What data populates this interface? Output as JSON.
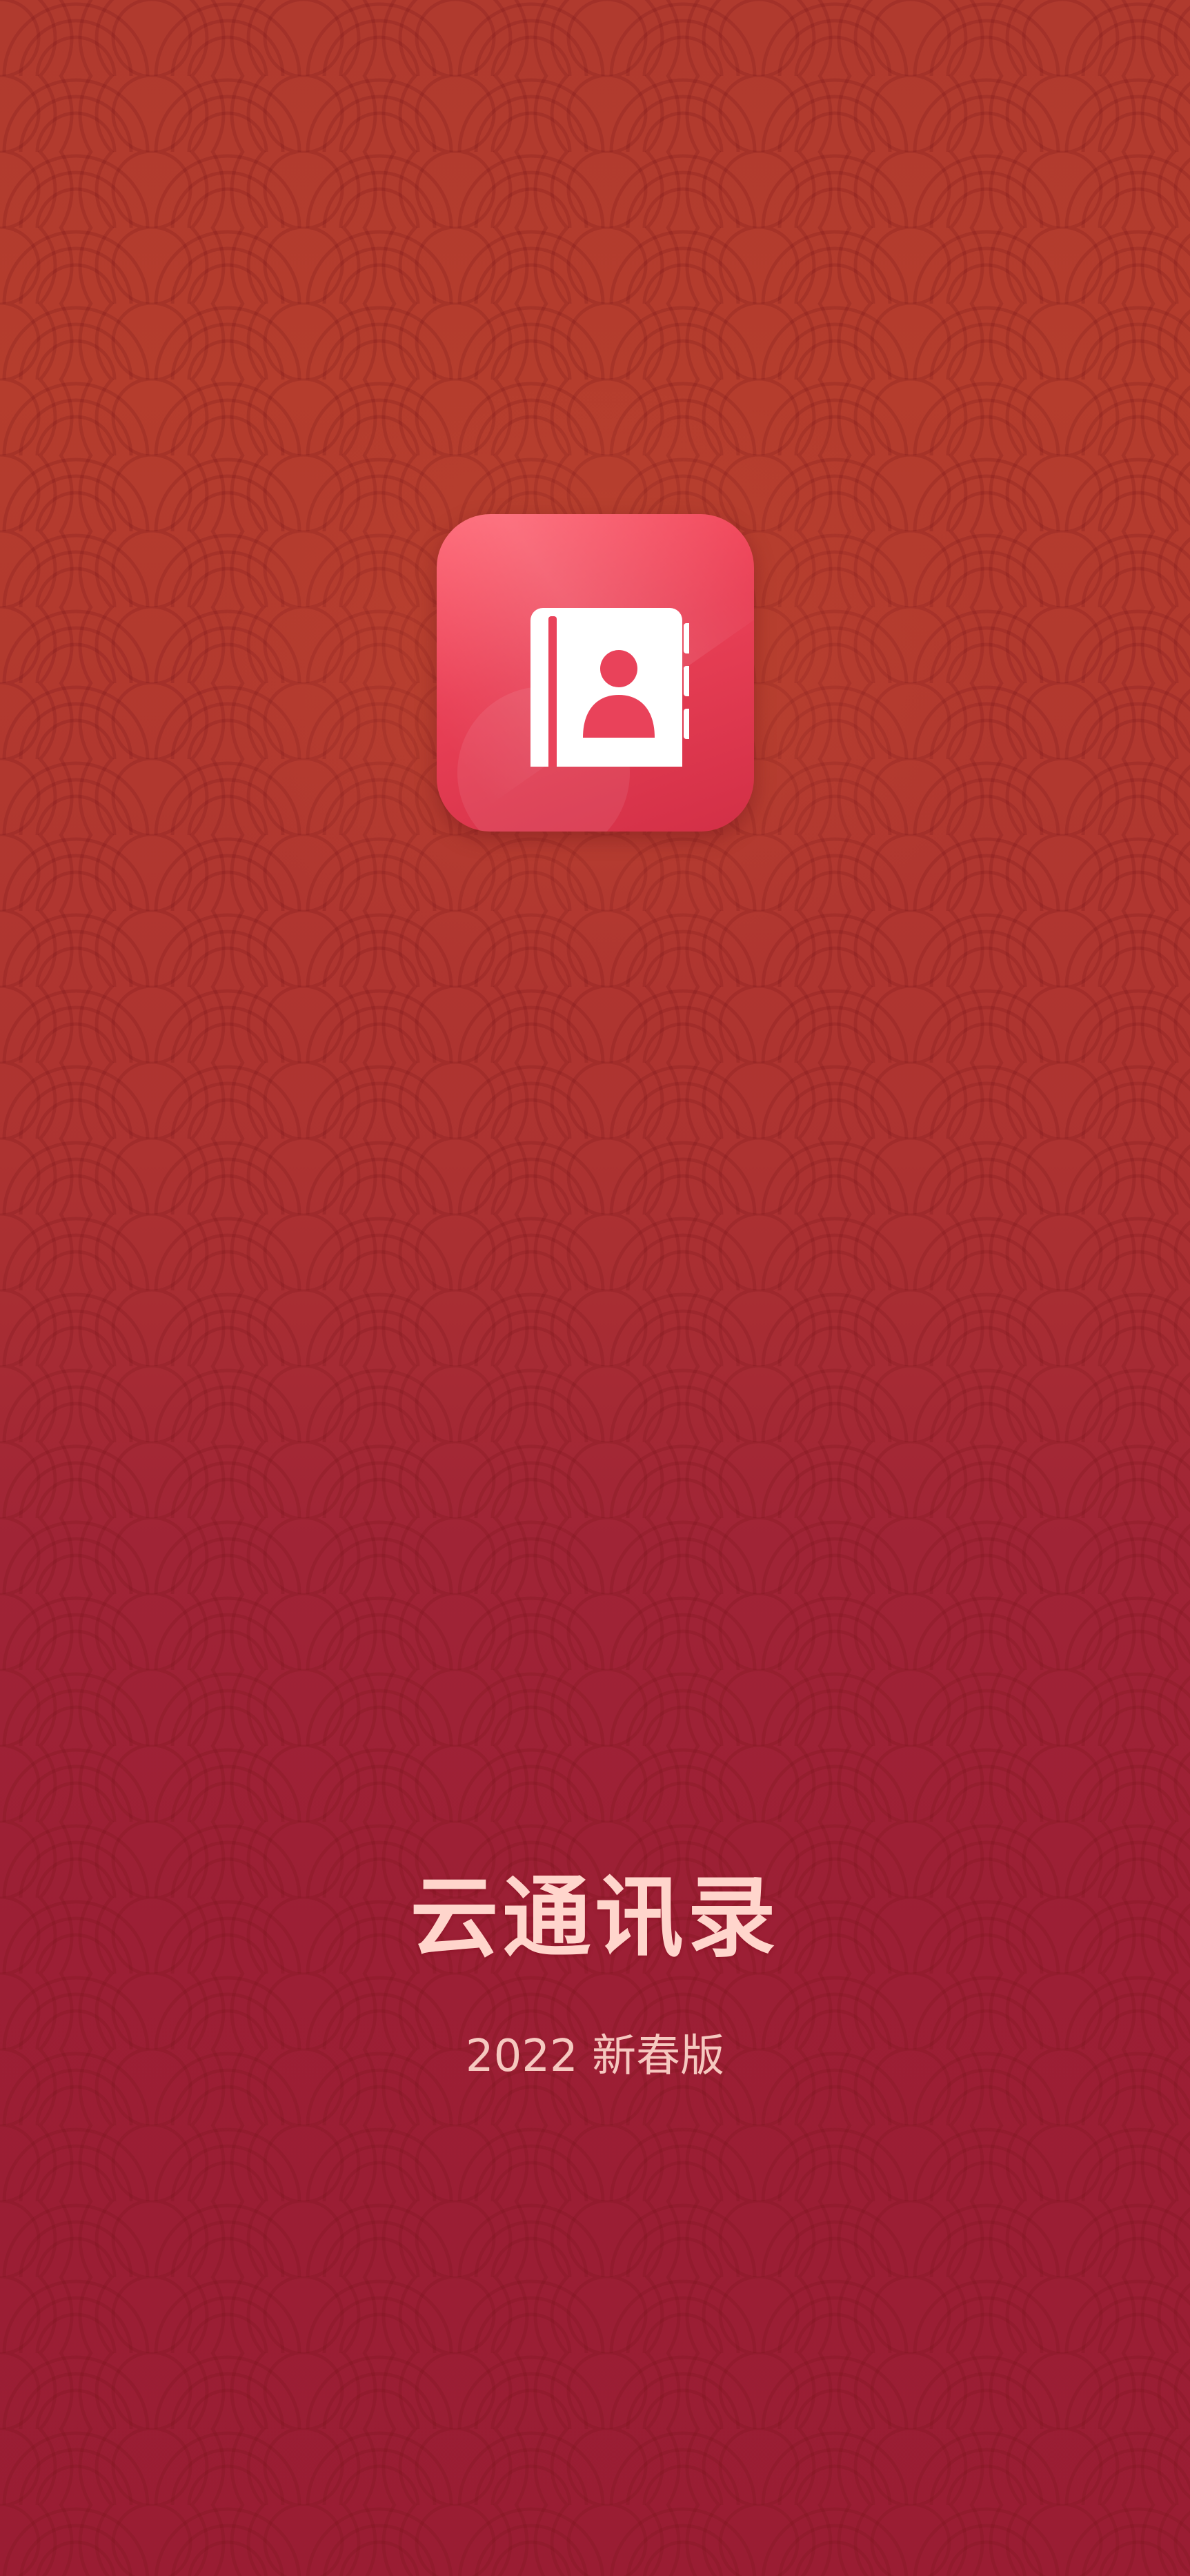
{
  "splash": {
    "app_title": "云通讯录",
    "subtitle": "2022 新春版",
    "icon": "contact-book-icon"
  },
  "colors": {
    "background_top": "#b03a2e",
    "background_bottom": "#9a1d33",
    "icon_gradient_start": "#ff5f6e",
    "icon_gradient_end": "#d22f46",
    "title_text": "#ffd5cc",
    "subtitle_text": "#f6c8c0"
  }
}
